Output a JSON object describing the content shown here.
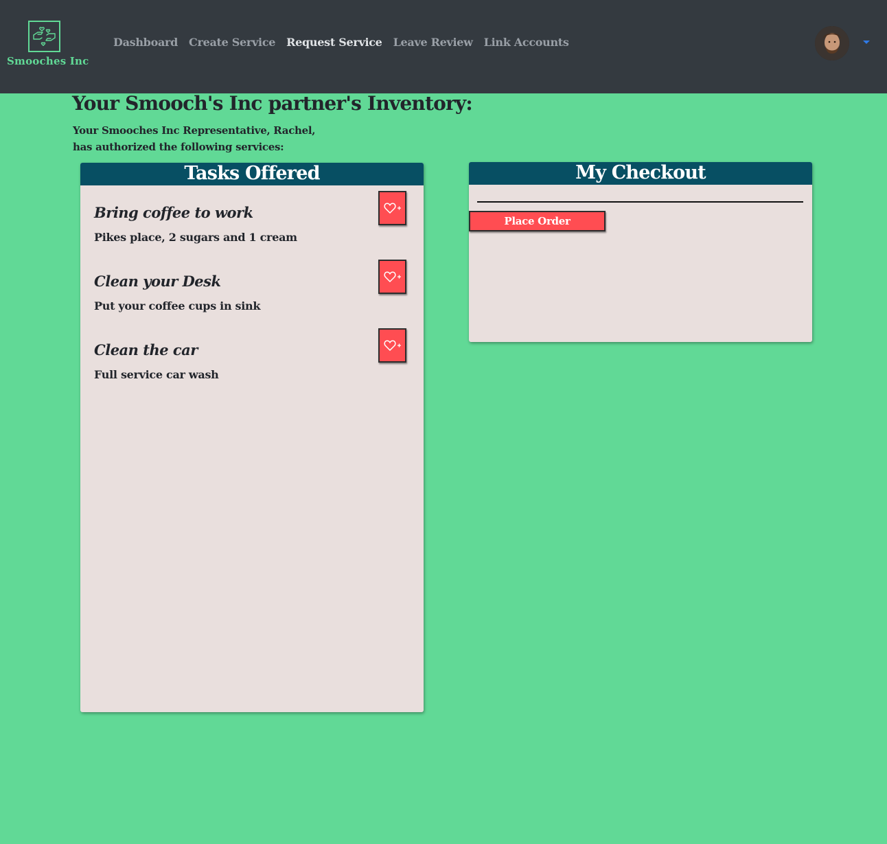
{
  "nav": {
    "brand_name": "Smooches Inc",
    "links": [
      {
        "label": "Dashboard",
        "active": false
      },
      {
        "label": "Create Service",
        "active": false
      },
      {
        "label": "Request Service",
        "active": true
      },
      {
        "label": "Leave Review",
        "active": false
      },
      {
        "label": "Link Accounts",
        "active": false
      }
    ],
    "avatar_icon": "user-avatar",
    "dropdown_icon": "caret-down-icon"
  },
  "page": {
    "title": "Your Smooch's Inc partner's Inventory:",
    "subtitle_line1": "Your Smooches Inc Representative, Rachel,",
    "subtitle_line2": "has authorized the following services:"
  },
  "tasks": {
    "header": "Tasks Offered",
    "items": [
      {
        "title": "Bring coffee to work",
        "description": "Pikes place, 2 sugars and 1 cream"
      },
      {
        "title": "Clean your Desk",
        "description": "Put your coffee cups in sink"
      },
      {
        "title": "Clean the car",
        "description": "Full service car wash"
      }
    ],
    "add_icon": "heart-plus-icon"
  },
  "checkout": {
    "header": "My Checkout",
    "place_order_label": "Place Order"
  },
  "colors": {
    "background": "#61d996",
    "navbar": "#343a40",
    "panel_header": "#074f63",
    "panel_body": "#e9dfdd",
    "button": "#ff4d52"
  }
}
